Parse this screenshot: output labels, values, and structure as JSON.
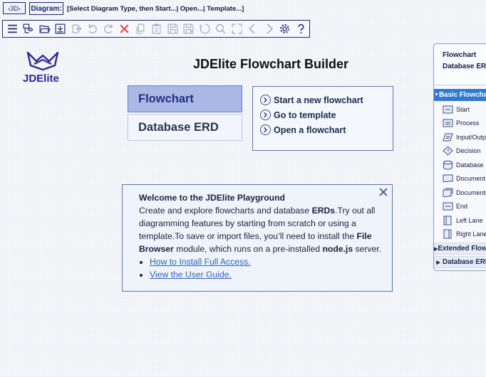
{
  "topbar": {
    "toggle_3d": "3D",
    "diagram_label": "Diagram:",
    "status": "[Select Diagram Type, then Start...| Open...| Template...]"
  },
  "toolbar": {
    "icons": [
      "menu-icon",
      "shapes-icon",
      "open-icon",
      "download-icon",
      "export-icon",
      "undo-icon",
      "redo-icon",
      "delete-icon",
      "copy-icon",
      "paste-icon",
      "save-icon",
      "save-as-icon",
      "reset-icon",
      "zoom-icon",
      "expand-icon",
      "back-icon",
      "forward-icon",
      "settings-icon",
      "help-icon"
    ]
  },
  "brand": {
    "logo_text": "JDElite",
    "accent": "#2d2a8a"
  },
  "header": {
    "title": "JDElite Flowchart Builder"
  },
  "diagram_types": [
    {
      "label": "Flowchart",
      "active": true
    },
    {
      "label": "Database ERD",
      "active": false
    }
  ],
  "start_options": [
    "Start a new flowchart",
    "Go to template",
    "Open a flowchart"
  ],
  "welcome": {
    "title": "Welcome to the JDElite Playground",
    "p1": "Create and explore flowcharts and database ",
    "b1": "ERDs",
    "p2": ".Try out all diagramming features by starting from scratch or using a template.To save or import files, you’ll need to install the ",
    "b2": "File Browser",
    "p3": " module, which runs on a pre-installed ",
    "b3": "node.js",
    "p4": " server.",
    "links": [
      "How to Install Full Access.",
      "View the User Guide."
    ]
  },
  "right_panel": {
    "header": [
      "Flowchart",
      "Database ERD"
    ],
    "sections": [
      {
        "title": "Basic Flowchart",
        "open": true
      },
      {
        "title": "Extended Flowchart",
        "open": false
      },
      {
        "title": "Database ERD",
        "open": false
      }
    ],
    "shapes": [
      "Start",
      "Process",
      "Input/Output",
      "Decision",
      "Database",
      "Document",
      "Documents",
      "End",
      "Left Lane",
      "Right Lane"
    ]
  }
}
